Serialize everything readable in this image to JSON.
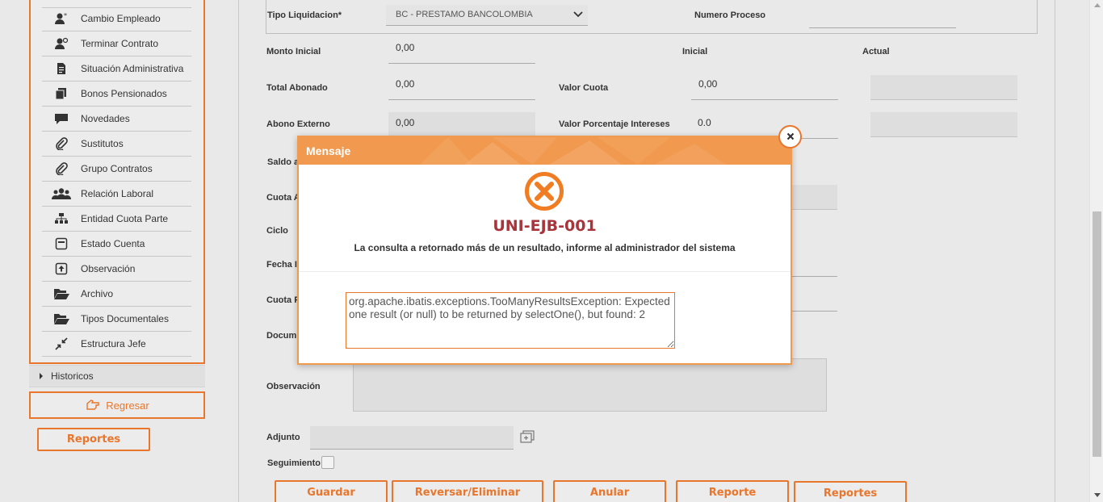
{
  "sidebar": {
    "items": [
      {
        "label": "Cambio Empleado",
        "icon": "user-star-icon"
      },
      {
        "label": "Terminar Contrato",
        "icon": "user-minus-icon"
      },
      {
        "label": "Situación Administrativa",
        "icon": "document-icon"
      },
      {
        "label": "Bonos Pensionados",
        "icon": "files-icon"
      },
      {
        "label": "Novedades",
        "icon": "comment-icon"
      },
      {
        "label": "Sustitutos",
        "icon": "paperclip-icon"
      },
      {
        "label": "Grupo Contratos",
        "icon": "paperclip-icon"
      },
      {
        "label": "Relación Laboral",
        "icon": "users-icon"
      },
      {
        "label": "Entidad Cuota Parte",
        "icon": "sitemap-icon"
      },
      {
        "label": "Estado Cuenta",
        "icon": "card-icon"
      },
      {
        "label": "Observación",
        "icon": "upload-box-icon"
      },
      {
        "label": "Archivo",
        "icon": "folder-open-icon"
      },
      {
        "label": "Tipos Documentales",
        "icon": "folder-open-icon"
      },
      {
        "label": "Estructura Jefe",
        "icon": "compress-icon"
      }
    ],
    "historicos": "Historicos",
    "regresar": "Regresar",
    "reportes": "Reportes"
  },
  "form": {
    "tipo_liquidacion_label": "Tipo Liquidacion*",
    "tipo_liquidacion_value": "BC - PRESTAMO BANCOLOMBIA",
    "numero_proceso_label": "Numero Proceso",
    "monto_inicial_label": "Monto Inicial",
    "monto_inicial_value": "0,00",
    "inicial_header": "Inicial",
    "actual_header": "Actual",
    "total_abonado_label": "Total Abonado",
    "total_abonado_value": "0,00",
    "valor_cuota_label": "Valor Cuota",
    "valor_cuota_value": "0,00",
    "abono_externo_label": "Abono Externo",
    "abono_externo_value": "0,00",
    "valor_porcentaje_label": "Valor Porcentaje Intereses",
    "valor_porcentaje_value": "0.0",
    "saldo_label": "Saldo a",
    "cuota_a_label": "Cuota A",
    "ciclo_label": "Ciclo",
    "fecha_label": "Fecha I",
    "cuota_p_label": "Cuota P",
    "documento_label": "Docum",
    "observacion_label": "Observación",
    "adjunto_label": "Adjunto",
    "seguimiento_label": "Seguimiento"
  },
  "actions": {
    "guardar": "Guardar",
    "reversar": "Reversar/Eliminar",
    "anular": "Anular",
    "reporte": "Reporte",
    "reportes": "Reportes"
  },
  "modal": {
    "title": "Mensaje",
    "code": "UNI-EJB-001",
    "message": "La consulta a retornado más de un resultado, informe al administrador del sistema",
    "detail": "org.apache.ibatis.exceptions.TooManyResultsException: Expected one result (or null) to be returned by selectOne(), but found: 2"
  },
  "colors": {
    "accent": "#e8762c",
    "modal_header": "#f0994f",
    "error_code": "#a8343c"
  }
}
